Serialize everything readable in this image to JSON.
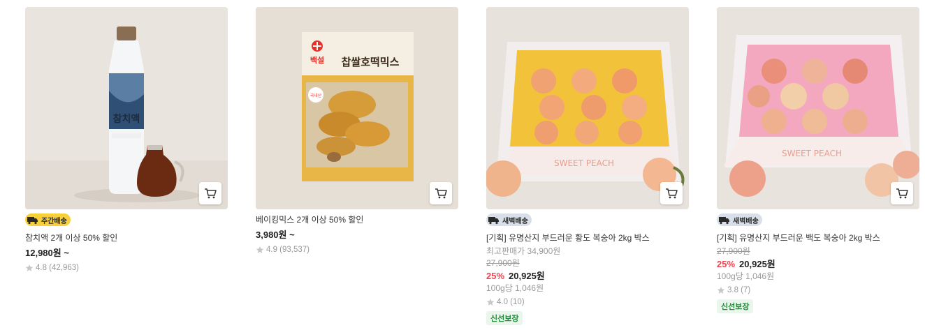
{
  "products": [
    {
      "badge": "주간배송",
      "title": "참치액 2개 이상 50% 할인",
      "price": "12,980원 ~",
      "rating": "4.8 (42,963)"
    },
    {
      "title": "베이킹믹스 2개 이상 50% 할인",
      "price": "3,980원 ~",
      "rating": "4.9 (93,537)",
      "box_brand": "백설",
      "box_title": "찹쌀호떡믹스"
    },
    {
      "badge": "새벽배송",
      "title": "[기획] 유명산지 부드러운 황도 복숭아 2kg 박스",
      "reference_price": "최고판매가 34,900원",
      "original_price": "27,900원",
      "discount_rate": "25%",
      "sale_price": "20,925원",
      "unit_price": "100g당 1,046원",
      "rating": "4.0 (10)",
      "fresh_badge": "신선보장"
    },
    {
      "badge": "새벽배송",
      "title": "[기획] 유명산지 부드러운 백도 복숭아 2kg 박스",
      "original_price": "27,900원",
      "discount_rate": "25%",
      "sale_price": "20,925원",
      "unit_price": "100g당 1,046원",
      "rating": "3.8 (7)",
      "fresh_badge": "신선보장"
    }
  ],
  "icons": {
    "cart": "cart-icon",
    "star": "star-icon",
    "truck": "truck-icon"
  },
  "colors": {
    "discount": "#f04452",
    "weekly_badge": "#f7cf3b",
    "dawn_badge": "#d9dfe8",
    "fresh": "#218a3b"
  }
}
